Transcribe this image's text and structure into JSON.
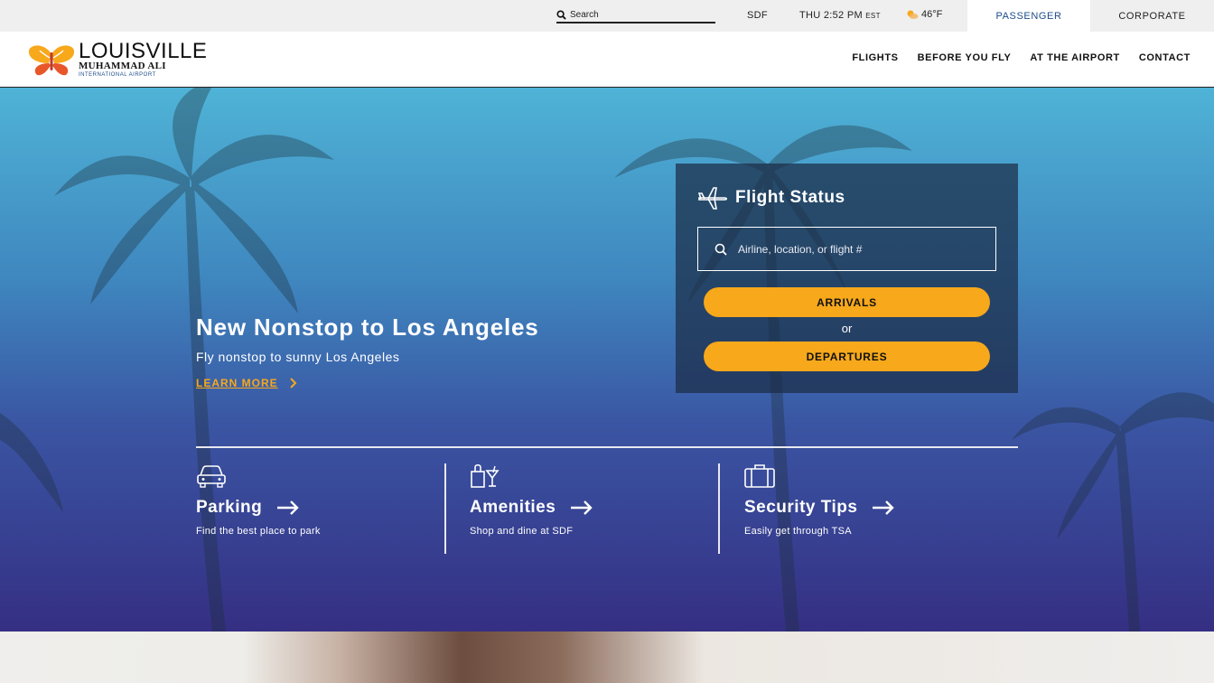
{
  "utility": {
    "search_placeholder": "Search",
    "airport_code": "SDF",
    "datetime": "THU 2:52 PM",
    "timezone": "EST",
    "temperature": "46°F",
    "tabs": [
      {
        "label": "PASSENGER"
      },
      {
        "label": "CORPORATE"
      }
    ]
  },
  "logo": {
    "line1": "LOUISVILLE",
    "line2": "MUHAMMAD ALI",
    "line3": "INTERNATIONAL AIRPORT"
  },
  "nav": {
    "items": [
      {
        "label": "FLIGHTS"
      },
      {
        "label": "BEFORE YOU FLY"
      },
      {
        "label": "AT THE AIRPORT"
      },
      {
        "label": "CONTACT"
      }
    ]
  },
  "hero": {
    "title": "New Nonstop to Los Angeles",
    "subtitle": "Fly nonstop to sunny Los Angeles",
    "cta": "LEARN MORE"
  },
  "flight_status": {
    "title": "Flight Status",
    "placeholder": "Airline, location, or flight #",
    "arrivals": "ARRIVALS",
    "or": "or",
    "departures": "DEPARTURES"
  },
  "cards": [
    {
      "title": "Parking",
      "subtitle": "Find the best place to park"
    },
    {
      "title": "Amenities",
      "subtitle": "Shop and dine at SDF"
    },
    {
      "title": "Security Tips",
      "subtitle": "Easily get through TSA"
    }
  ],
  "colors": {
    "accent": "#f7a81b",
    "brand_blue": "#1e4c8a",
    "hero_top": "#4fb3d6",
    "hero_bottom": "#352f83"
  },
  "icons": {
    "search": "search-icon",
    "weather": "partly-cloudy-icon",
    "plane": "airplane-icon",
    "parking": "car-icon",
    "amenities": "shopping-drink-icon",
    "security": "suitcase-icon",
    "arrow": "arrow-right-icon"
  }
}
